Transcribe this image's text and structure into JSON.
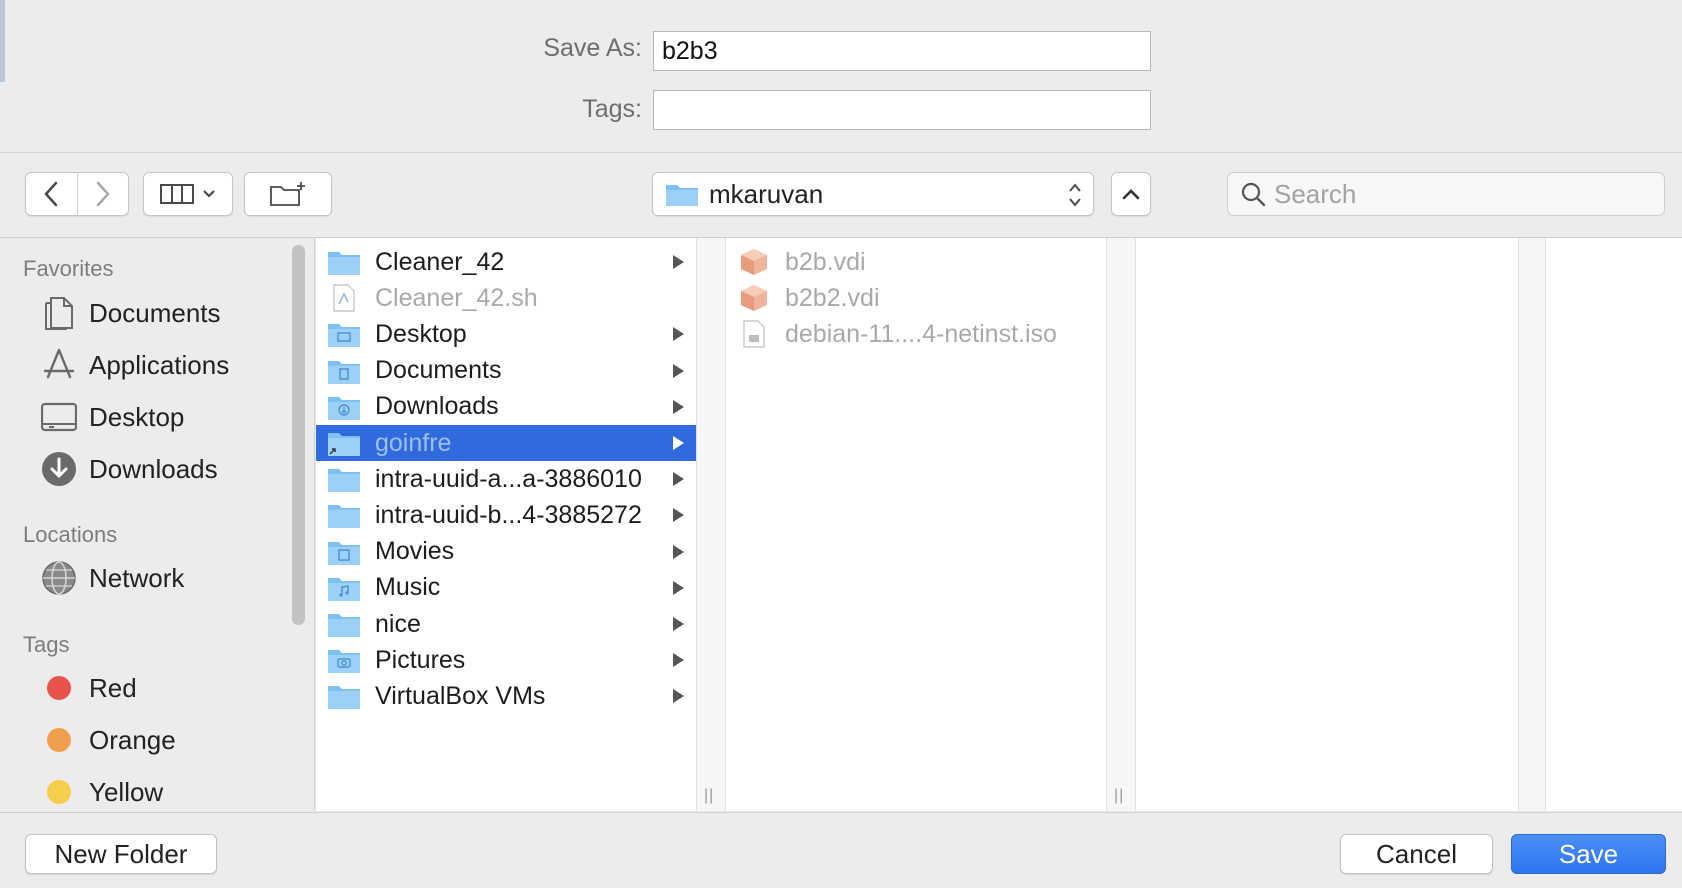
{
  "form": {
    "save_as_label": "Save As:",
    "save_as_value": "b2b3",
    "tags_label": "Tags:",
    "tags_value": ""
  },
  "toolbar": {
    "back_icon": "chevron-left-icon",
    "forward_icon": "chevron-right-icon",
    "view_icon": "column-view-icon",
    "new_folder_icon": "new-folder-icon",
    "location": "mkaruvan",
    "search_placeholder": "Search"
  },
  "sidebar": {
    "favorites_header": "Favorites",
    "favorites": [
      {
        "label": "Documents",
        "icon": "document-icon"
      },
      {
        "label": "Applications",
        "icon": "applications-icon"
      },
      {
        "label": "Desktop",
        "icon": "desktop-icon"
      },
      {
        "label": "Downloads",
        "icon": "download-icon"
      }
    ],
    "locations_header": "Locations",
    "locations": [
      {
        "label": "Network",
        "icon": "network-globe-icon"
      }
    ],
    "tags_header": "Tags",
    "tags": [
      {
        "label": "Red",
        "color": "#e9534d"
      },
      {
        "label": "Orange",
        "color": "#f0a04a"
      },
      {
        "label": "Yellow",
        "color": "#f5cf4b"
      }
    ]
  },
  "columns": {
    "first": [
      {
        "name": "Cleaner_42",
        "type": "folder",
        "chevron": true,
        "selected": false,
        "dim": false
      },
      {
        "name": "Cleaner_42.sh",
        "type": "script",
        "chevron": false,
        "selected": false,
        "dim": true
      },
      {
        "name": "Desktop",
        "type": "folder",
        "chevron": true,
        "selected": false,
        "dim": false
      },
      {
        "name": "Documents",
        "type": "folder",
        "chevron": true,
        "selected": false,
        "dim": false
      },
      {
        "name": "Downloads",
        "type": "folder",
        "chevron": true,
        "selected": false,
        "dim": false
      },
      {
        "name": "goinfre",
        "type": "folder-alias",
        "chevron": true,
        "selected": true,
        "dim": false
      },
      {
        "name": "intra-uuid-a...a-3886010",
        "type": "folder",
        "chevron": true,
        "selected": false,
        "dim": false
      },
      {
        "name": "intra-uuid-b...4-3885272",
        "type": "folder",
        "chevron": true,
        "selected": false,
        "dim": false
      },
      {
        "name": "Movies",
        "type": "folder",
        "chevron": true,
        "selected": false,
        "dim": false
      },
      {
        "name": "Music",
        "type": "folder",
        "chevron": true,
        "selected": false,
        "dim": false
      },
      {
        "name": "nice",
        "type": "folder",
        "chevron": true,
        "selected": false,
        "dim": false
      },
      {
        "name": "Pictures",
        "type": "folder",
        "chevron": true,
        "selected": false,
        "dim": false
      },
      {
        "name": "VirtualBox VMs",
        "type": "folder",
        "chevron": true,
        "selected": false,
        "dim": false
      }
    ],
    "second": [
      {
        "name": "b2b.vdi",
        "type": "vdi"
      },
      {
        "name": "b2b2.vdi",
        "type": "vdi"
      },
      {
        "name": "debian-11....4-netinst.iso",
        "type": "iso"
      }
    ]
  },
  "bottom": {
    "new_folder_label": "New Folder",
    "cancel_label": "Cancel",
    "save_label": "Save"
  },
  "colors": {
    "accent": "#2f6bdd",
    "folder": "#7fc0f2"
  }
}
